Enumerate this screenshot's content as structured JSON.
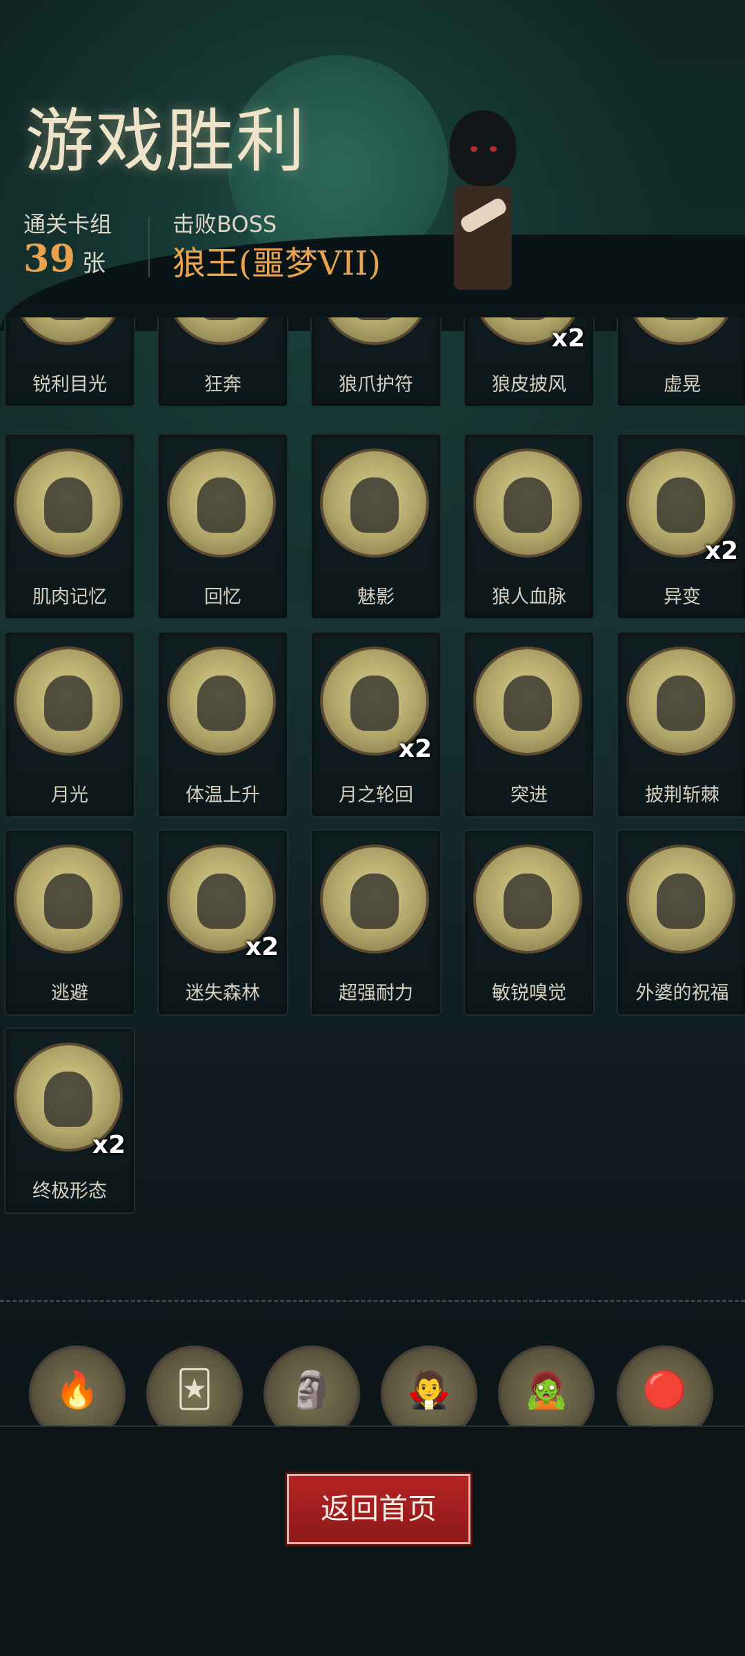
{
  "header": {
    "title": "游戏胜利",
    "cleared_deck_label": "通关卡组",
    "cleared_deck_count": "39",
    "cleared_deck_unit": "张",
    "boss_label": "击败BOSS",
    "boss_name": "狼王(噩梦VII)"
  },
  "cards": [
    {
      "name": "锐利目光",
      "count": ""
    },
    {
      "name": "狂奔",
      "count": ""
    },
    {
      "name": "狼爪护符",
      "count": ""
    },
    {
      "name": "狼皮披风",
      "count": "x2"
    },
    {
      "name": "虚晃",
      "count": ""
    },
    {
      "name": "肌肉记忆",
      "count": ""
    },
    {
      "name": "回忆",
      "count": ""
    },
    {
      "name": "魅影",
      "count": ""
    },
    {
      "name": "狼人血脉",
      "count": ""
    },
    {
      "name": "异变",
      "count": "x2"
    },
    {
      "name": "月光",
      "count": ""
    },
    {
      "name": "体温上升",
      "count": ""
    },
    {
      "name": "月之轮回",
      "count": "x2"
    },
    {
      "name": "突进",
      "count": ""
    },
    {
      "name": "披荆斩棘",
      "count": ""
    },
    {
      "name": "逃避",
      "count": ""
    },
    {
      "name": "迷失森林",
      "count": "x2"
    },
    {
      "name": "超强耐力",
      "count": ""
    },
    {
      "name": "敏锐嗅觉",
      "count": ""
    },
    {
      "name": "外婆的祝福",
      "count": ""
    },
    {
      "name": "终极形态",
      "count": "x2"
    }
  ],
  "relics": [
    {
      "icon": "fire-altar-icon",
      "glyph": "🔥"
    },
    {
      "icon": "spiral-card-icon",
      "glyph": "🃏"
    },
    {
      "icon": "statue-icon",
      "glyph": "🗿"
    },
    {
      "icon": "vampire-icon",
      "glyph": "🧛"
    },
    {
      "icon": "zombie-icon",
      "glyph": "🧟"
    },
    {
      "icon": "red-orbs-icon",
      "glyph": "🔴"
    }
  ],
  "footer": {
    "return_label": "返回首页"
  },
  "colors": {
    "accent_orange": "#e9a34f",
    "button_red": "#b42424"
  }
}
